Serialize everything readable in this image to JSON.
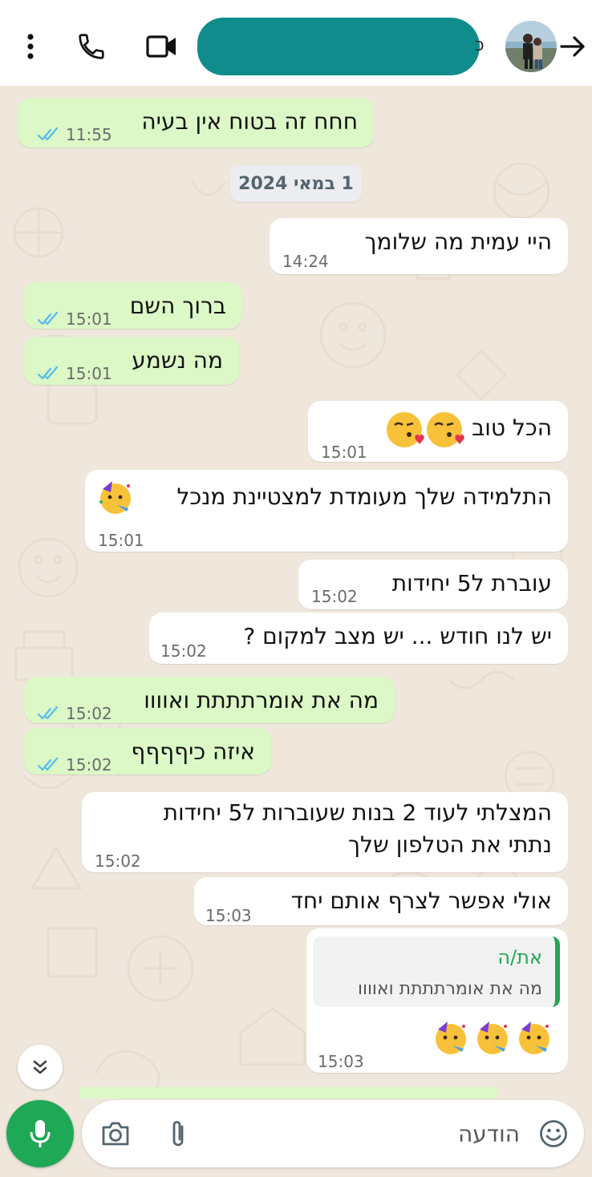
{
  "header": {
    "contact_name_visible_tail": "כ",
    "menu_icon": "more-vert-icon",
    "call_icon": "phone-icon",
    "video_icon": "video-camera-icon",
    "back_icon": "arrow-back-icon"
  },
  "messages": [
    {
      "dir": "out",
      "text": "חחח זה בטוח אין בעיה",
      "time": "11:55",
      "read": true
    },
    {
      "dir": "date",
      "text": "1 במאי 2024"
    },
    {
      "dir": "in",
      "text": "היי עמית מה שלומך",
      "time": "14:24"
    },
    {
      "dir": "out",
      "text": "ברוך השם",
      "time": "15:01",
      "read": true
    },
    {
      "dir": "out",
      "text": "מה נשמע",
      "time": "15:01",
      "read": true
    },
    {
      "dir": "in",
      "text": "הכל טוב",
      "time": "15:01",
      "emoji": "face-blowing-kiss"
    },
    {
      "dir": "in",
      "text": "התלמידה שלך מעומדת למצטיינת מנכל",
      "time": "15:01",
      "emoji": "partying-face"
    },
    {
      "dir": "in",
      "text": "עוברת ל5 יחידות",
      "time": "15:02"
    },
    {
      "dir": "in",
      "text": "יש לנו חודש ... יש מצב למקום ?",
      "time": "15:02"
    },
    {
      "dir": "out",
      "text": "מה את אומרתתתת ואוווו",
      "time": "15:02",
      "read": true
    },
    {
      "dir": "out",
      "text": "איזה כיףףףף",
      "time": "15:02",
      "read": true
    },
    {
      "dir": "in",
      "lines": [
        "המצלתי לעוד 2 בנות שעוברות ל5 יחידות",
        "נתתי את הטלפון שלך"
      ],
      "time": "15:02"
    },
    {
      "dir": "in",
      "text": "אולי אפשר לצרף אותם יחד",
      "time": "15:03"
    },
    {
      "dir": "in",
      "reply": {
        "author": "את/ה",
        "text": "מה את אומרתתתת ואוווו"
      },
      "emoji": "partying-face x3",
      "time": "15:03"
    }
  ],
  "composer": {
    "placeholder": "הודעה",
    "value": "",
    "emoji_icon": "emoji-icon",
    "attach_icon": "paperclip-icon",
    "camera_icon": "camera-icon",
    "mic_icon": "microphone-icon",
    "scroll_icon": "double-chevron-down-icon"
  },
  "colors": {
    "accent": "#1fa855",
    "outgoing_bubble": "#dbf8c6",
    "incoming_bubble": "#ffffff",
    "chat_background": "#efe7dc",
    "read_ticks": "#53bdeb"
  }
}
